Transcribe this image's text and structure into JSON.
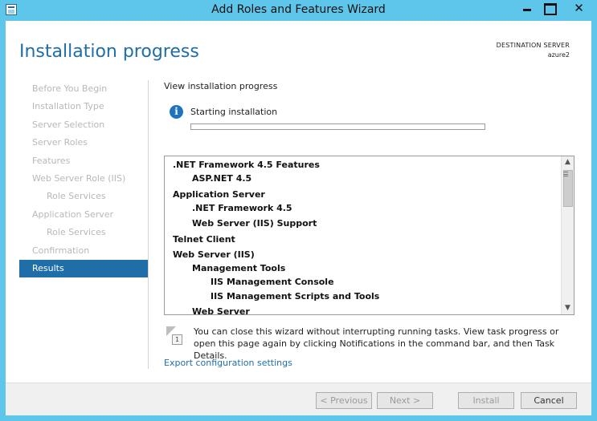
{
  "window": {
    "title": "Add Roles and Features Wizard",
    "close_glyph": "✕"
  },
  "header": {
    "heading": "Installation progress",
    "destination_label": "DESTINATION SERVER",
    "destination_name": "azure2"
  },
  "nav": {
    "items": [
      {
        "label": "Before You Begin"
      },
      {
        "label": "Installation Type"
      },
      {
        "label": "Server Selection"
      },
      {
        "label": "Server Roles"
      },
      {
        "label": "Features"
      },
      {
        "label": "Web Server Role (IIS)"
      },
      {
        "label": "Role Services"
      },
      {
        "label": "Application Server"
      },
      {
        "label": "Role Services"
      },
      {
        "label": "Confirmation"
      },
      {
        "label": "Results"
      }
    ]
  },
  "main": {
    "sub_heading": "View installation progress",
    "info_glyph": "i",
    "status": "Starting installation",
    "progress_fraction": 0.0,
    "features": [
      {
        "label": ".NET Framework 4.5 Features",
        "level": 0
      },
      {
        "label": "ASP.NET 4.5",
        "level": 1
      },
      {
        "label": "Application Server",
        "level": 0
      },
      {
        "label": ".NET Framework 4.5",
        "level": 1
      },
      {
        "label": "Web Server (IIS) Support",
        "level": 1
      },
      {
        "label": "Telnet Client",
        "level": 0
      },
      {
        "label": "Web Server (IIS)",
        "level": 0
      },
      {
        "label": "Management Tools",
        "level": 1
      },
      {
        "label": "IIS Management Console",
        "level": 2
      },
      {
        "label": "IIS Management Scripts and Tools",
        "level": 2
      },
      {
        "label": "Web Server",
        "level": 1
      }
    ],
    "note_badge": "1",
    "note": "You can close this wizard without interrupting running tasks. View task progress or open this page again by clicking Notifications in the command bar, and then Task Details.",
    "export_link": "Export configuration settings"
  },
  "footer": {
    "previous": "< Previous",
    "next": "Next >",
    "install": "Install",
    "cancel": "Cancel"
  }
}
